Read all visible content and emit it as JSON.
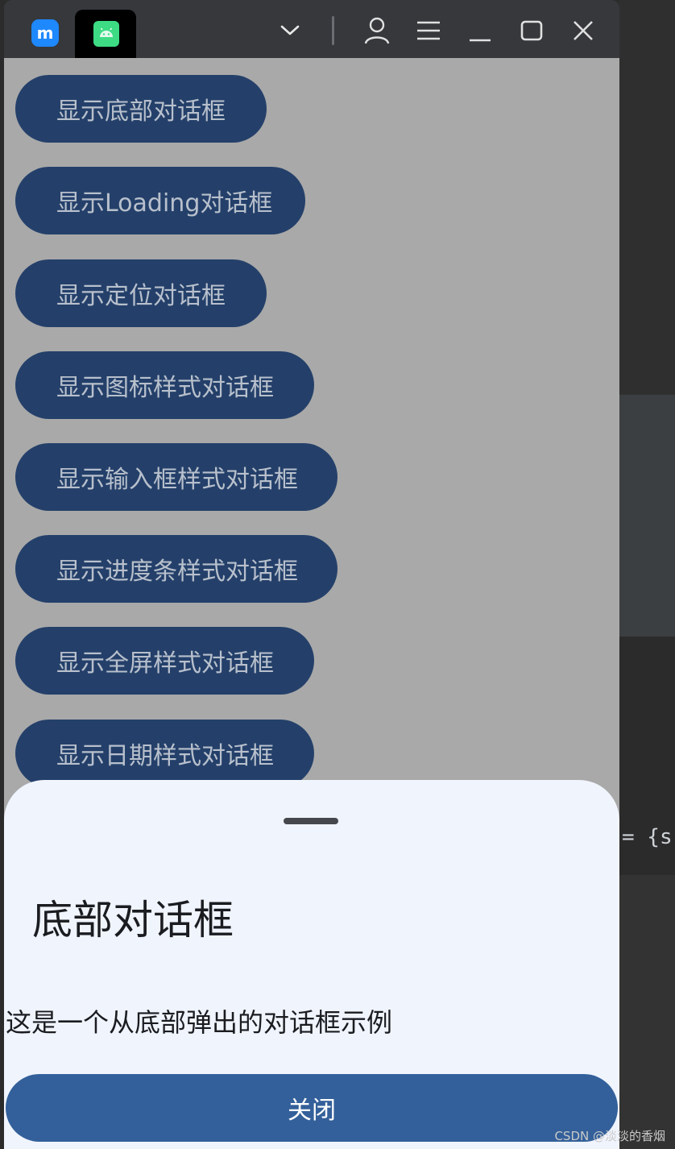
{
  "background_ide": {
    "code_fragment": "= {s"
  },
  "titlebar": {
    "app_logo_text": "m"
  },
  "buttons": [
    {
      "label": "显示底部对话框"
    },
    {
      "label": "显示Loading对话框"
    },
    {
      "label": "显示定位对话框"
    },
    {
      "label": "显示图标样式对话框"
    },
    {
      "label": "显示输入框样式对话框"
    },
    {
      "label": "显示进度条样式对话框"
    },
    {
      "label": "显示全屏样式对话框"
    },
    {
      "label": "显示日期样式对话框"
    }
  ],
  "bottom_sheet": {
    "title": "底部对话框",
    "message": "这是一个从底部弹出的对话框示例",
    "close_label": "关闭"
  },
  "watermark": "CSDN @淡淡的香烟",
  "colors": {
    "titlebar": "#36383c",
    "scrim": "#a9a9a9",
    "button_bg": "#24406a",
    "sheet_bg": "#f0f4fd",
    "close_button_bg": "#33609a"
  }
}
